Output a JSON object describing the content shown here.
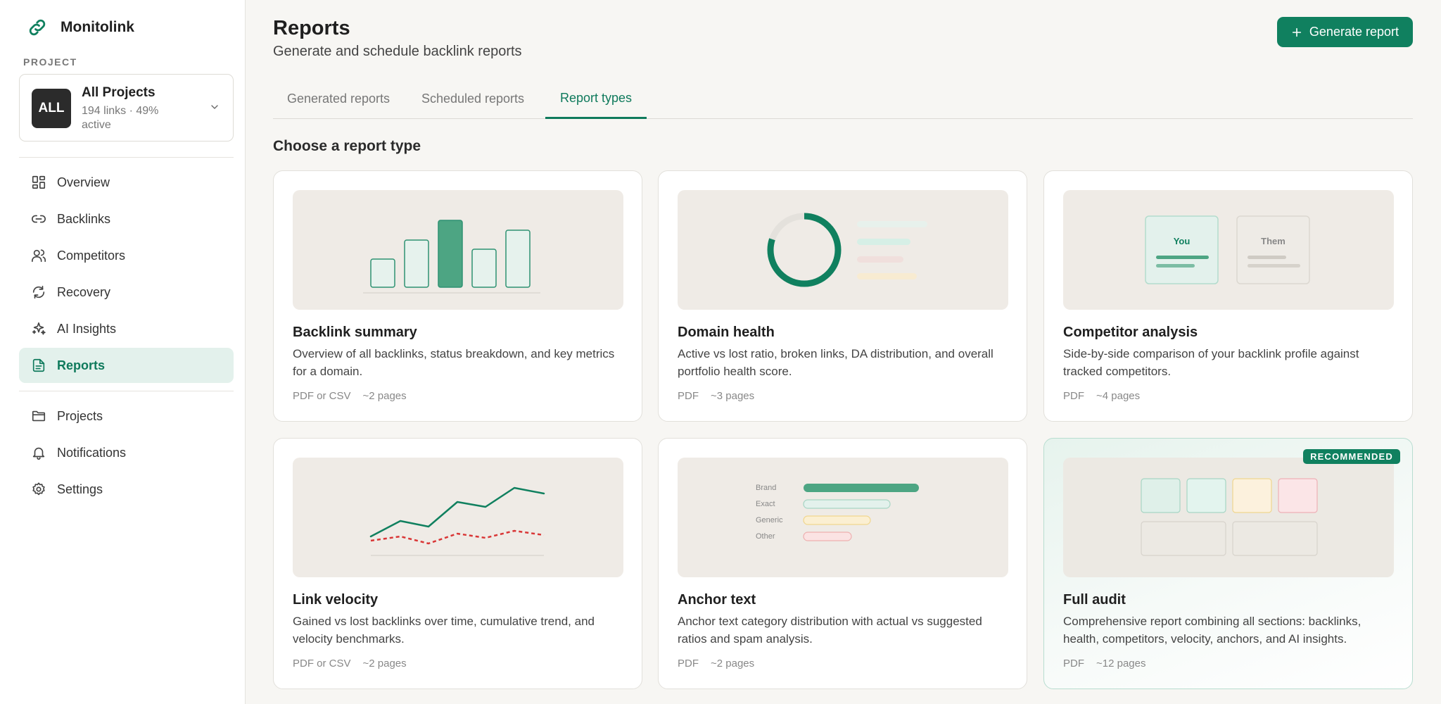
{
  "app": {
    "name": "Monitolink"
  },
  "project": {
    "section_label": "PROJECT",
    "avatar": "ALL",
    "name": "All Projects",
    "meta": "194 links · 49% active"
  },
  "nav": {
    "primary": [
      {
        "label": "Overview",
        "icon": "grid-icon"
      },
      {
        "label": "Backlinks",
        "icon": "link-icon"
      },
      {
        "label": "Competitors",
        "icon": "users-icon"
      },
      {
        "label": "Recovery",
        "icon": "refresh-icon"
      },
      {
        "label": "AI Insights",
        "icon": "sparkles-icon"
      },
      {
        "label": "Reports",
        "icon": "document-icon",
        "active": true
      }
    ],
    "secondary": [
      {
        "label": "Projects",
        "icon": "folder-icon"
      },
      {
        "label": "Notifications",
        "icon": "bell-icon"
      },
      {
        "label": "Settings",
        "icon": "gear-icon"
      }
    ]
  },
  "header": {
    "title": "Reports",
    "subtitle": "Generate and schedule backlink reports",
    "generate_label": "Generate report"
  },
  "tabs": [
    {
      "label": "Generated reports"
    },
    {
      "label": "Scheduled reports"
    },
    {
      "label": "Report types",
      "active": true
    }
  ],
  "section_title": "Choose a report type",
  "cards": [
    {
      "title": "Backlink summary",
      "desc": "Overview of all backlinks, status breakdown, and key metrics for a domain.",
      "format": "PDF or CSV",
      "pages": "~2 pages"
    },
    {
      "title": "Domain health",
      "desc": "Active vs lost ratio, broken links, DA distribution, and overall portfolio health score.",
      "format": "PDF",
      "pages": "~3 pages"
    },
    {
      "title": "Competitor analysis",
      "desc": "Side-by-side comparison of your backlink profile against tracked competitors.",
      "format": "PDF",
      "pages": "~4 pages"
    },
    {
      "title": "Link velocity",
      "desc": "Gained vs lost backlinks over time, cumulative trend, and velocity benchmarks.",
      "format": "PDF or CSV",
      "pages": "~2 pages"
    },
    {
      "title": "Anchor text",
      "desc": "Anchor text category distribution with actual vs suggested ratios and spam analysis.",
      "format": "PDF",
      "pages": "~2 pages"
    },
    {
      "title": "Full audit",
      "desc": "Comprehensive report combining all sections: backlinks, health, competitors, velocity, anchors, and AI insights.",
      "format": "PDF",
      "pages": "~12 pages",
      "badge": "RECOMMENDED"
    }
  ],
  "thumbnails": {
    "competitor": {
      "you": "You",
      "them": "Them"
    },
    "anchor_labels": [
      "Brand",
      "Exact",
      "Generic",
      "Other"
    ]
  },
  "colors": {
    "accent": "#10805f",
    "accent_light": "#e3f1ec",
    "red": "#d93636"
  }
}
